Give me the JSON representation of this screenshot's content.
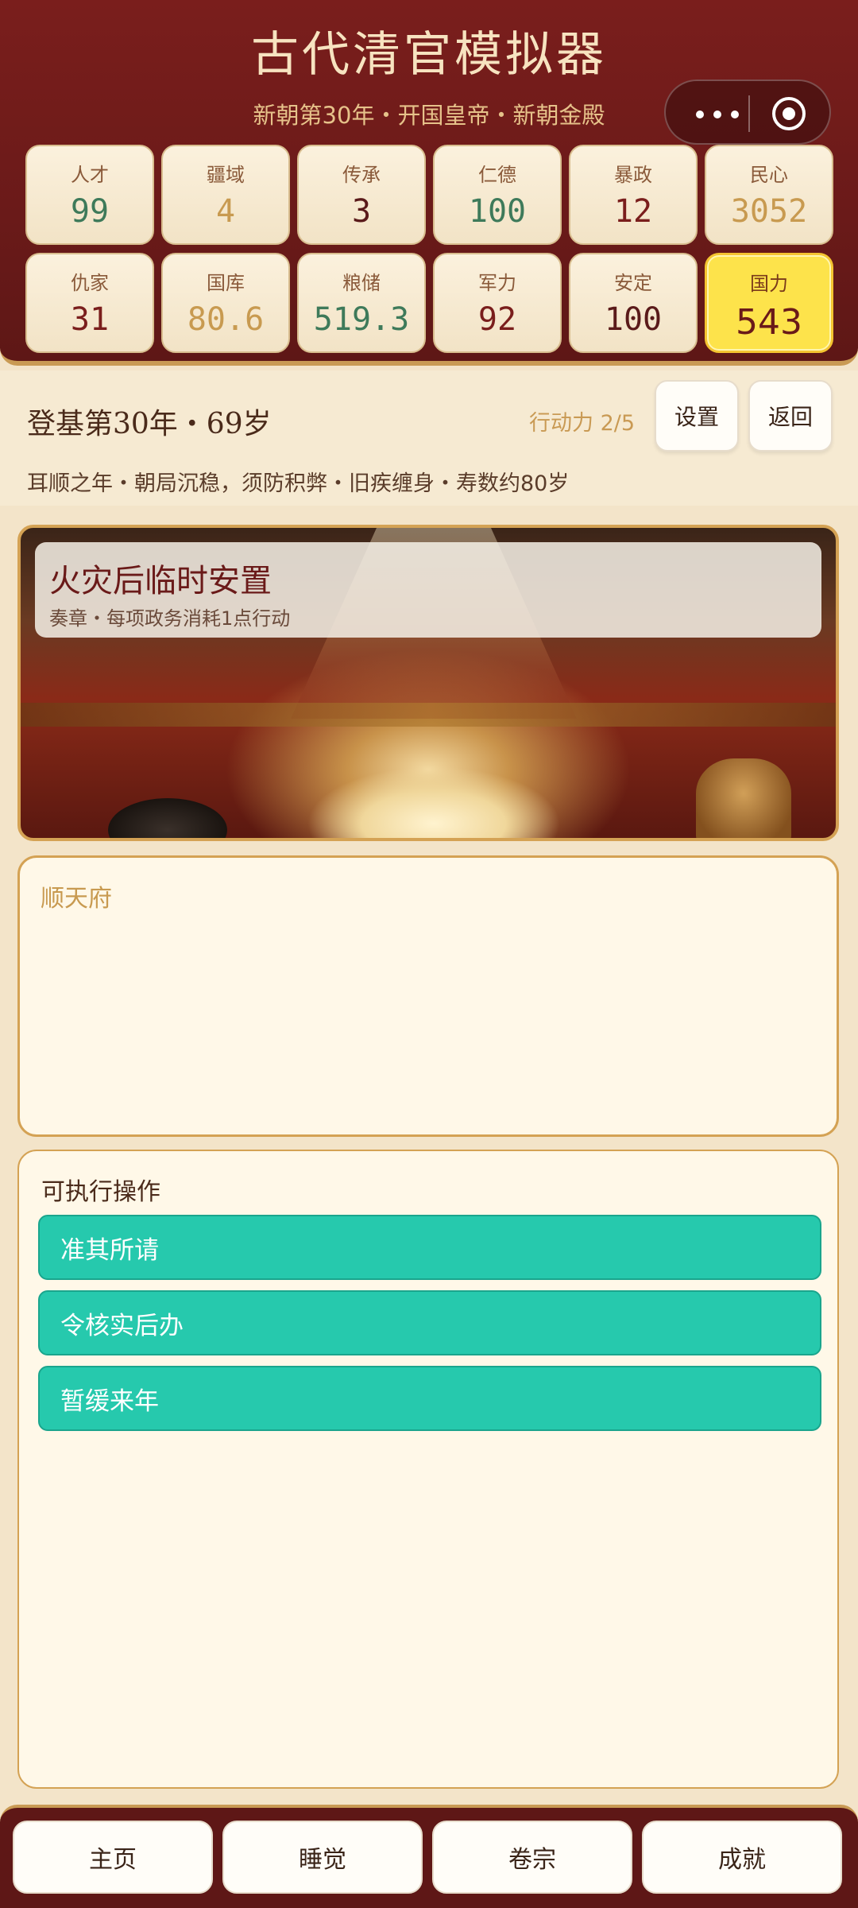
{
  "header": {
    "title": "古代清官模拟器",
    "subtitle": "新朝第30年・开国皇帝・新朝金殿"
  },
  "stats": [
    {
      "label": "人才",
      "value": "99",
      "color": "#3e7a5a"
    },
    {
      "label": "疆域",
      "value": "4",
      "color": "#c89a50"
    },
    {
      "label": "传承",
      "value": "3",
      "color": "#5a1a1a"
    },
    {
      "label": "仁德",
      "value": "100",
      "color": "#3e7a5a"
    },
    {
      "label": "暴政",
      "value": "12",
      "color": "#7a1e1c"
    },
    {
      "label": "民心",
      "value": "3052",
      "color": "#c89a50"
    },
    {
      "label": "仇家",
      "value": "31",
      "color": "#7a1e1c"
    },
    {
      "label": "国库",
      "value": "80.6",
      "color": "#c89a50"
    },
    {
      "label": "粮储",
      "value": "519.3",
      "color": "#3e7a5a"
    },
    {
      "label": "军力",
      "value": "92",
      "color": "#7a1e1c"
    },
    {
      "label": "安定",
      "value": "100",
      "color": "#5a1a1a"
    },
    {
      "label": "国力",
      "value": "543",
      "color": "#6a1a19"
    }
  ],
  "status": {
    "reign": "登基第30年・69岁",
    "action_points": "行动力 2/5",
    "settings_label": "设置",
    "back_label": "返回",
    "description": "耳顺之年・朝局沉稳，须防积弊・旧疾缠身・寿数约80岁"
  },
  "memorial": {
    "title": "火灾后临时安置",
    "subtitle": "奏章・每项政务消耗1点行动"
  },
  "text_panel": {
    "place": "顺天府"
  },
  "actions": {
    "heading": "可执行操作",
    "options": [
      "准其所请",
      "令核实后办",
      "暂缓来年"
    ]
  },
  "nav": {
    "items": [
      "主页",
      "睡觉",
      "卷宗",
      "成就"
    ]
  },
  "colors": {
    "header_bg": "#6a1a19",
    "accent_gold": "#c99a54",
    "action_button": "#26c9ad",
    "highlight": "#fde34b"
  }
}
